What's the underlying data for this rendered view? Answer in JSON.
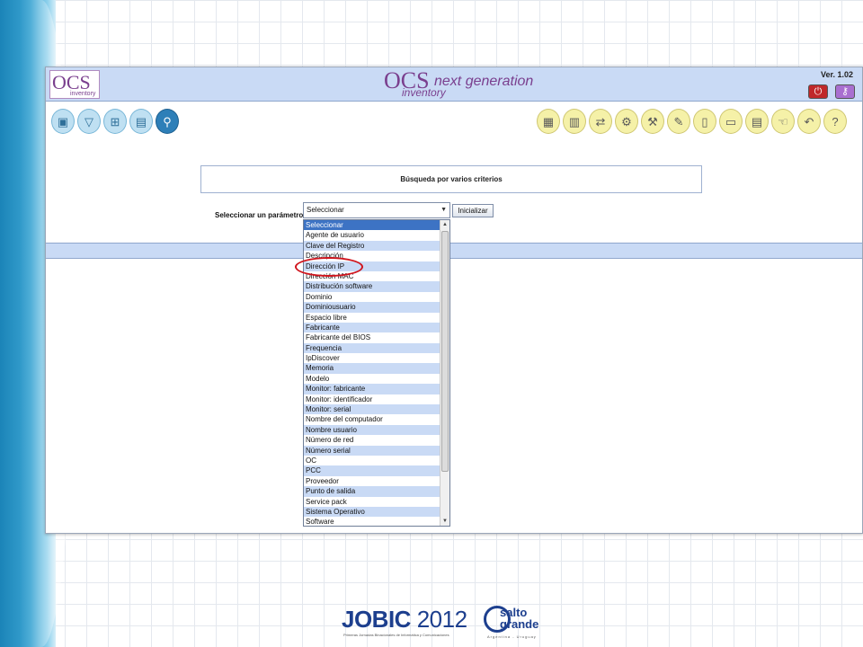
{
  "header": {
    "logo_small": "OCS",
    "logo_small_sub": "inventory",
    "logo_center_main": "OCS",
    "logo_center_gen": "next generation",
    "logo_center_inv": "inventory",
    "version": "Ver. 1.02",
    "power_icon": "power-icon",
    "key_icon": "key-icon"
  },
  "toolbar_left": [
    {
      "name": "computers-icon",
      "glyph": "▣"
    },
    {
      "name": "filter-icon",
      "glyph": "▽"
    },
    {
      "name": "network-icon",
      "glyph": "⊞"
    },
    {
      "name": "groups-icon",
      "glyph": "▤"
    },
    {
      "name": "search-icon",
      "glyph": "⚲"
    }
  ],
  "toolbar_right": [
    {
      "name": "gift-icon",
      "glyph": "▦"
    },
    {
      "name": "inventory-icon",
      "glyph": "▥"
    },
    {
      "name": "transfer-icon",
      "glyph": "⇄"
    },
    {
      "name": "settings-icon",
      "glyph": "⚙"
    },
    {
      "name": "tools-icon",
      "glyph": "⚒"
    },
    {
      "name": "edit-icon",
      "glyph": "✎"
    },
    {
      "name": "documents-icon",
      "glyph": "▯"
    },
    {
      "name": "window-icon",
      "glyph": "▭"
    },
    {
      "name": "report-icon",
      "glyph": "▤"
    },
    {
      "name": "hand-icon",
      "glyph": "☜"
    },
    {
      "name": "back-icon",
      "glyph": "↶"
    },
    {
      "name": "help-icon",
      "glyph": "?"
    }
  ],
  "search": {
    "title": "Búsqueda por varios criterios",
    "param_label": "Seleccionar un parámetro:",
    "select_value": "Seleccionar",
    "init_button": "Inicializar"
  },
  "dropdown": {
    "selected": "Seleccionar",
    "highlighted": "Dirección IP",
    "options": [
      "Seleccionar",
      "Agente de usuario",
      "Clave del Registro",
      "Descripción",
      "Dirección IP",
      "Dirección MAC",
      "Distribución software",
      "Dominio",
      "Dominiousuario",
      "Espacio libre",
      "Fabricante",
      "Fabricante del BIOS",
      "Frequencia",
      "IpDiscover",
      "Memoria",
      "Modelo",
      "Monitor: fabricante",
      "Monitor: identificador",
      "Monitor: serial",
      "Nombre del computador",
      "Nombre usuario",
      "Número de red",
      "Número serial",
      "OC",
      "PCC",
      "Proveedor",
      "Punto de salida",
      "Service pack",
      "Sistema Operativo",
      "Software"
    ]
  },
  "footer": {
    "jobic": "JOBIC",
    "year": "2012",
    "jobic_sub": "Primeras Jornadas Binacionales de Informática y Comunicaciones",
    "sg_line1": "salto",
    "sg_line2": "grande",
    "sg_sub": "Argentina - Uruguay"
  },
  "colors": {
    "header_bg": "#c9daf5",
    "brand_purple": "#7a3f8e",
    "selection": "#3d73c4",
    "highlight_ring": "#d0141c"
  }
}
